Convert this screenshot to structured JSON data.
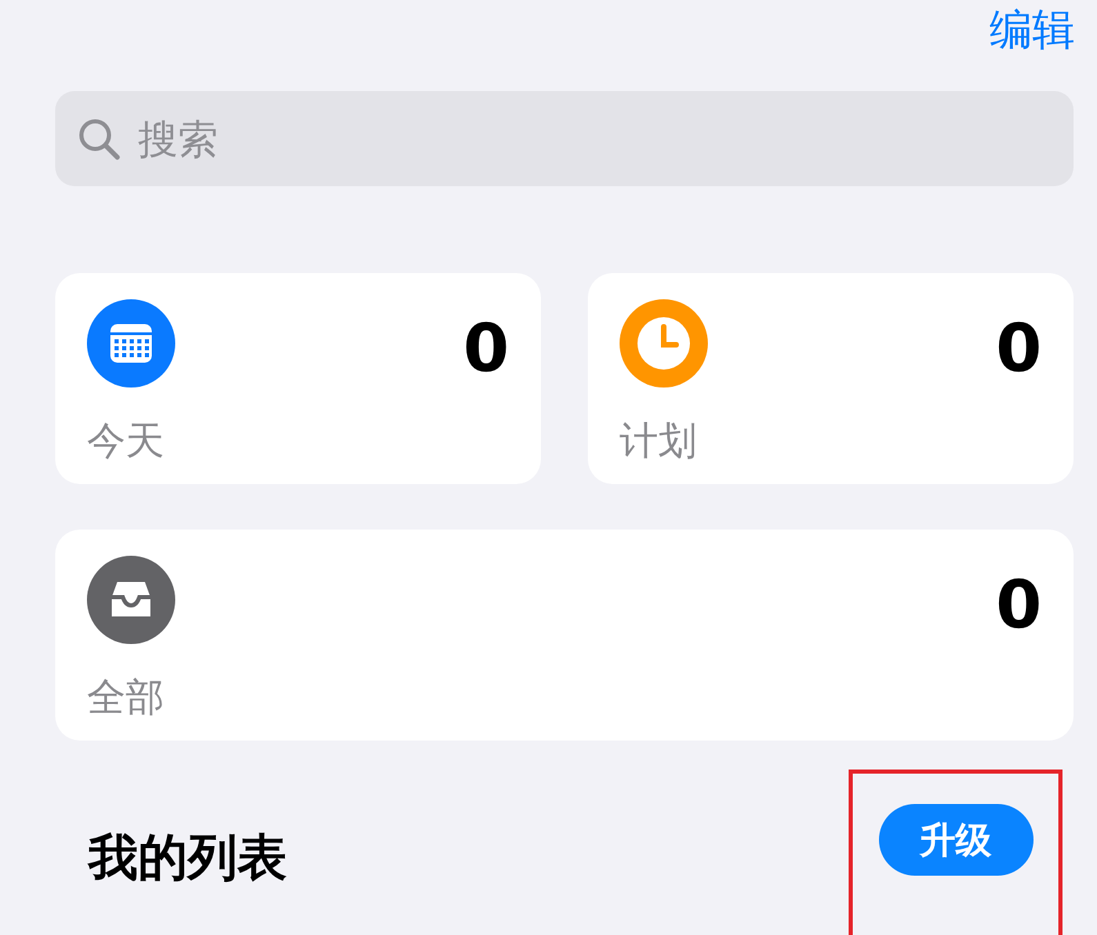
{
  "nav": {
    "edit": "编辑"
  },
  "search": {
    "placeholder": "搜索"
  },
  "smart_lists": [
    {
      "kind": "today",
      "label": "今天",
      "count": "0"
    },
    {
      "kind": "scheduled",
      "label": "计划",
      "count": "0"
    },
    {
      "kind": "all",
      "label": "全部",
      "count": "0"
    }
  ],
  "section": {
    "title": "我的列表",
    "button": "升级",
    "highlighted": true
  }
}
